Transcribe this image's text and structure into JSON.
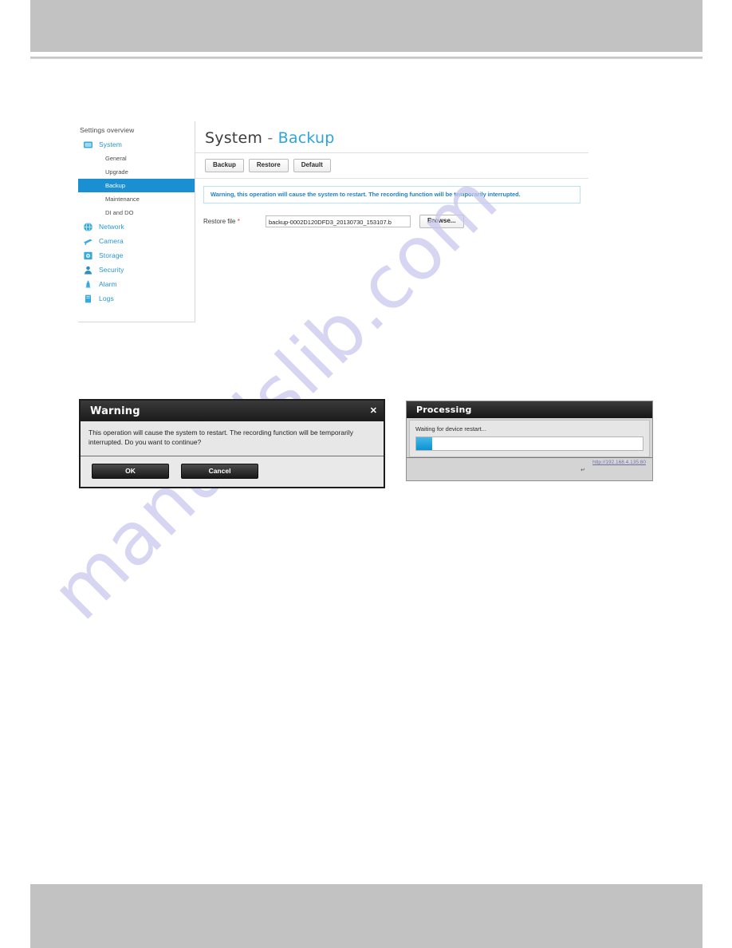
{
  "watermark": {
    "text": "manualslib.com"
  },
  "settings_panel": {
    "sidebar": {
      "overview_label": "Settings overview",
      "groups": [
        {
          "label": "System",
          "icon": "system-icon",
          "children": [
            {
              "label": "General",
              "selected": false
            },
            {
              "label": "Upgrade",
              "selected": false
            },
            {
              "label": "Backup",
              "selected": true
            },
            {
              "label": "Maintenance",
              "selected": false
            },
            {
              "label": "DI and DO",
              "selected": false
            }
          ]
        },
        {
          "label": "Network",
          "icon": "network-icon",
          "children": []
        },
        {
          "label": "Camera",
          "icon": "camera-icon",
          "children": []
        },
        {
          "label": "Storage",
          "icon": "storage-icon",
          "children": []
        },
        {
          "label": "Security",
          "icon": "security-icon",
          "children": []
        },
        {
          "label": "Alarm",
          "icon": "alarm-icon",
          "children": []
        },
        {
          "label": "Logs",
          "icon": "logs-icon",
          "children": []
        }
      ]
    },
    "content": {
      "title_main": "System",
      "title_dash": "-",
      "title_accent": "Backup",
      "tabs": [
        {
          "label": "Backup"
        },
        {
          "label": "Restore"
        },
        {
          "label": "Default"
        }
      ],
      "warning_banner": "Warning, this operation will cause the system to restart. The recording function will be temporarily interrupted.",
      "restore_file_label": "Restore file",
      "required_marker": "*",
      "restore_file_value": "backup-0002D120DFD3_20130730_153107.b",
      "restore_file_placeholder": "",
      "browse_label": "Browse..."
    }
  },
  "warning_dialog": {
    "title": "Warning",
    "close_icon": "✕",
    "message": "This operation will cause the system to restart. The recording function will be temporarily interrupted. Do you want to continue?",
    "ok_label": "OK",
    "cancel_label": "Cancel"
  },
  "processing_dialog": {
    "title": "Processing",
    "status": "Waiting for device restart...",
    "progress_percent": 7,
    "url": "http://192.168.4.135:80",
    "link_icon": "↵"
  },
  "colors": {
    "accent_blue": "#1a8fd1",
    "title_accent": "#2fa4db",
    "banner_text": "#2483c4",
    "required_red": "#e03a3a",
    "band_gray": "#c2c2c2",
    "watermark": "#c9c8ee"
  }
}
